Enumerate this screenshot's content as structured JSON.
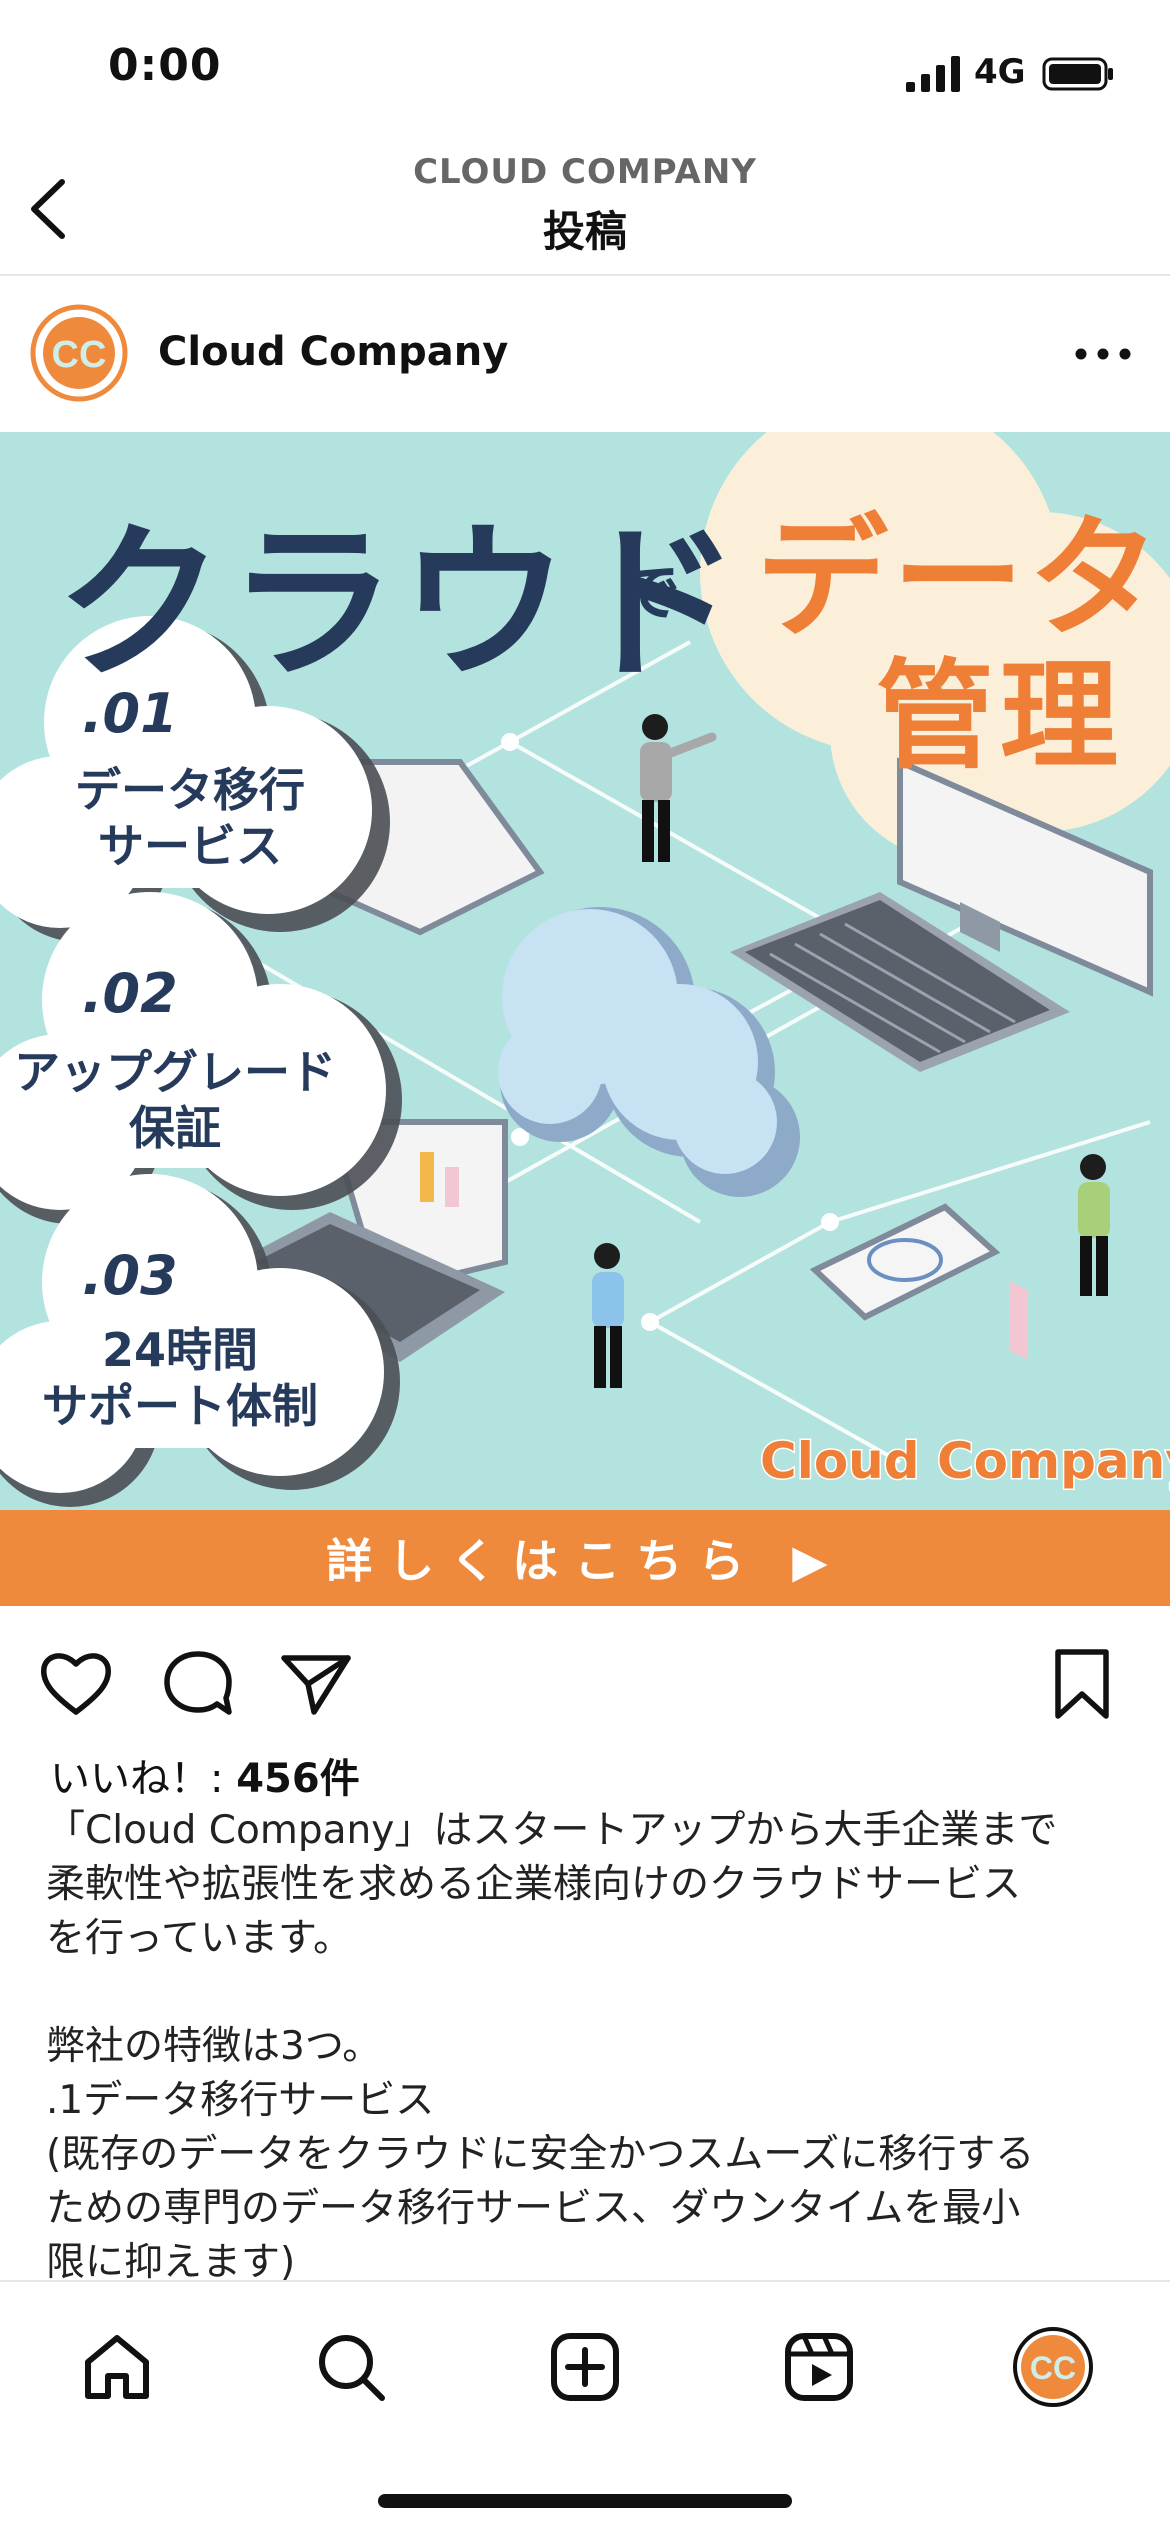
{
  "status_bar": {
    "time": "0:00",
    "network": "4G"
  },
  "header": {
    "subtitle": "CLOUD COMPANY",
    "title": "投稿"
  },
  "post": {
    "username": "Cloud Company",
    "avatar_text": "CC",
    "image": {
      "title": "クラウド",
      "title_particle": "で",
      "highlight_line1": "データ",
      "highlight_line2": "管理",
      "features": [
        {
          "number": ".01",
          "text": "データ移行\nサービス"
        },
        {
          "number": ".02",
          "text": "アップグレード\n保証"
        },
        {
          "number": ".03",
          "text": "24時間\nサポート体制"
        }
      ],
      "brand": "Cloud Company"
    },
    "cta_label": "詳しくはこちら ▶",
    "likes_prefix": "いいね！: ",
    "likes_count": "456件",
    "caption": "「Cloud Company」はスタートアップから大手企業まで\n柔軟性や拡張性を求める企業様向けのクラウドサービス\nを行っています。\n\n弊社の特徴は3つ。\n.1データ移行サービス\n(既存のデータをクラウドに安全かつスムーズに移行する\nための専門のデータ移行サービス、ダウンタイムを最小\n限に抑えます)"
  },
  "tab_bar": {
    "items": [
      "home-icon",
      "search-icon",
      "create-icon",
      "reels-icon",
      "profile-avatar"
    ]
  },
  "colors": {
    "accent_orange": "#ef8a3c",
    "banner_bg": "#b2e3df",
    "navy": "#263b5c"
  }
}
